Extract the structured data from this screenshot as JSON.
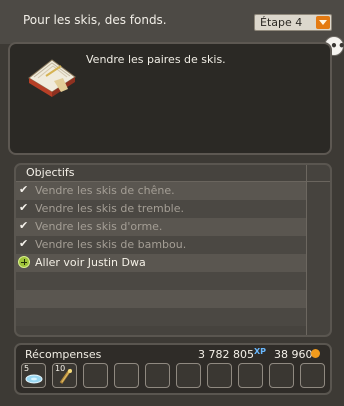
{
  "header": {
    "quest_title": "Pour les skis, des fonds.",
    "step_label": "Étape 4"
  },
  "quest": {
    "description": "Vendre les paires de skis."
  },
  "objectives": {
    "title": "Objectifs",
    "items": [
      {
        "label": "Vendre les skis de chêne.",
        "state": "done"
      },
      {
        "label": "Vendre les skis de tremble.",
        "state": "done"
      },
      {
        "label": "Vendre les skis d'orme.",
        "state": "done"
      },
      {
        "label": "Vendre les skis de bambou.",
        "state": "done"
      },
      {
        "label": "Aller voir Justin Dwa",
        "state": "active"
      }
    ]
  },
  "rewards": {
    "label": "Récompenses",
    "xp": "3 782 805",
    "xp_unit": "XP",
    "kamas": "38 960",
    "items": [
      {
        "icon": "disk-icon",
        "count": "5"
      },
      {
        "icon": "scroll-icon",
        "count": "10"
      }
    ]
  },
  "icons": {
    "chat": "chat-bubble-icon",
    "book": "book-icon",
    "check": "checkmark-icon",
    "plus": "plus-icon",
    "kamas": "kamas-icon"
  },
  "colors": {
    "accent_orange": "#e47a12",
    "active_green": "#9fc43a",
    "xp_blue": "#69b8ff"
  }
}
